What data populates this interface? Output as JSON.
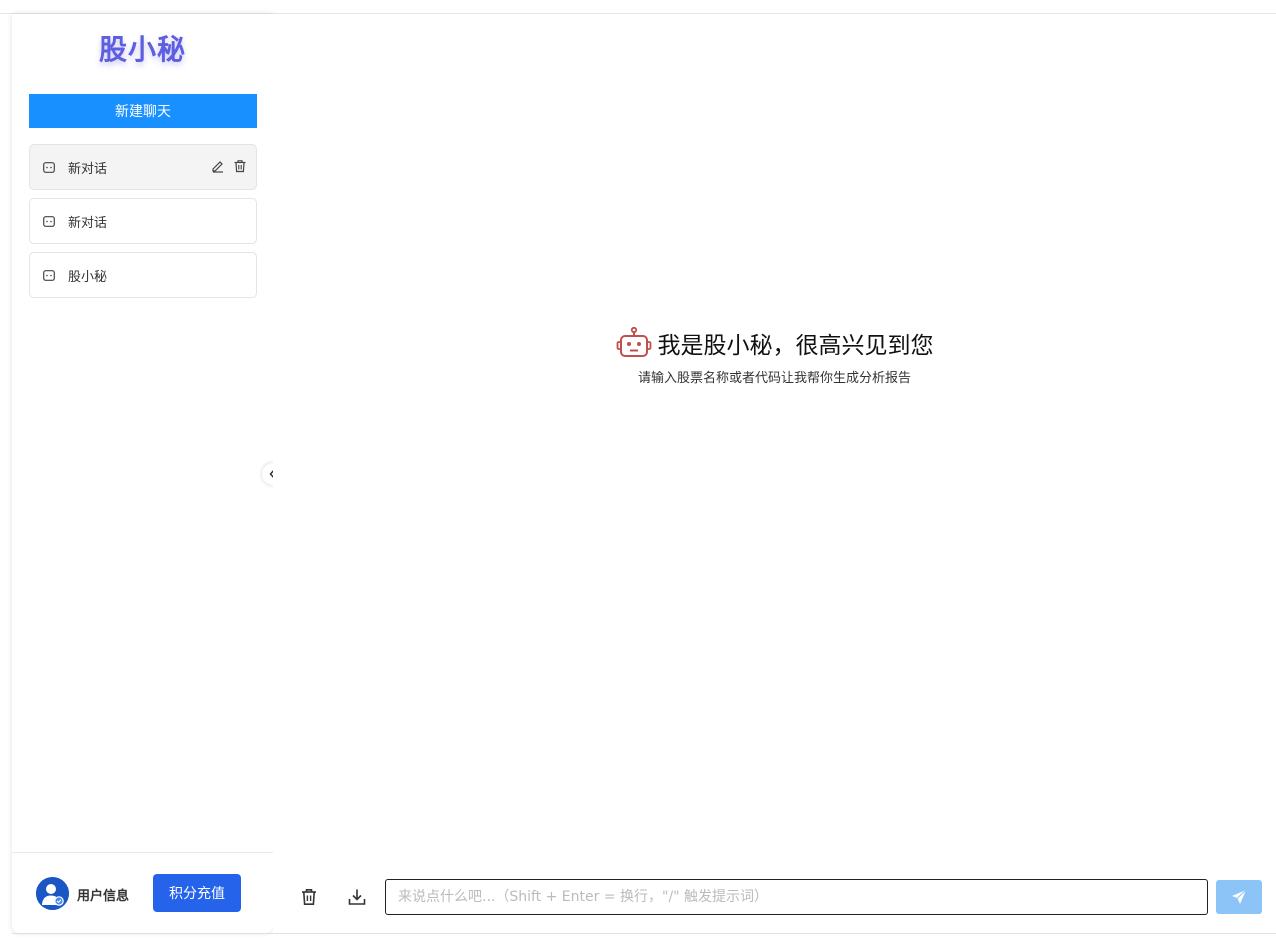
{
  "sidebar": {
    "logo": "股小秘",
    "new_chat_label": "新建聊天",
    "conversations": [
      {
        "label": "新对话",
        "active": true
      },
      {
        "label": "新对话",
        "active": false
      },
      {
        "label": "股小秘",
        "active": false
      }
    ],
    "user_info_label": "用户信息",
    "recharge_label": "积分充值"
  },
  "main": {
    "welcome_title": "我是股小秘，很高兴见到您",
    "welcome_subtitle": "请输入股票名称或者代码让我帮你生成分析报告",
    "input_placeholder": "来说点什么吧...（Shift + Enter = 换行，\"/\" 触发提示词）",
    "input_value": ""
  },
  "icons": {
    "conversation": "chat-bubble-icon",
    "edit": "edit-icon",
    "delete": "trash-icon",
    "collapse": "chevron-left-icon",
    "robot": "robot-icon",
    "clear": "trash-icon",
    "download": "download-icon",
    "send": "send-icon"
  },
  "colors": {
    "primary": "#1890ff",
    "recharge": "#2563eb",
    "send_disabled": "#8cc4f7",
    "robot": "#c0504d",
    "logo_gradient_start": "#4a7de8",
    "logo_gradient_end": "#8a4fe0"
  }
}
